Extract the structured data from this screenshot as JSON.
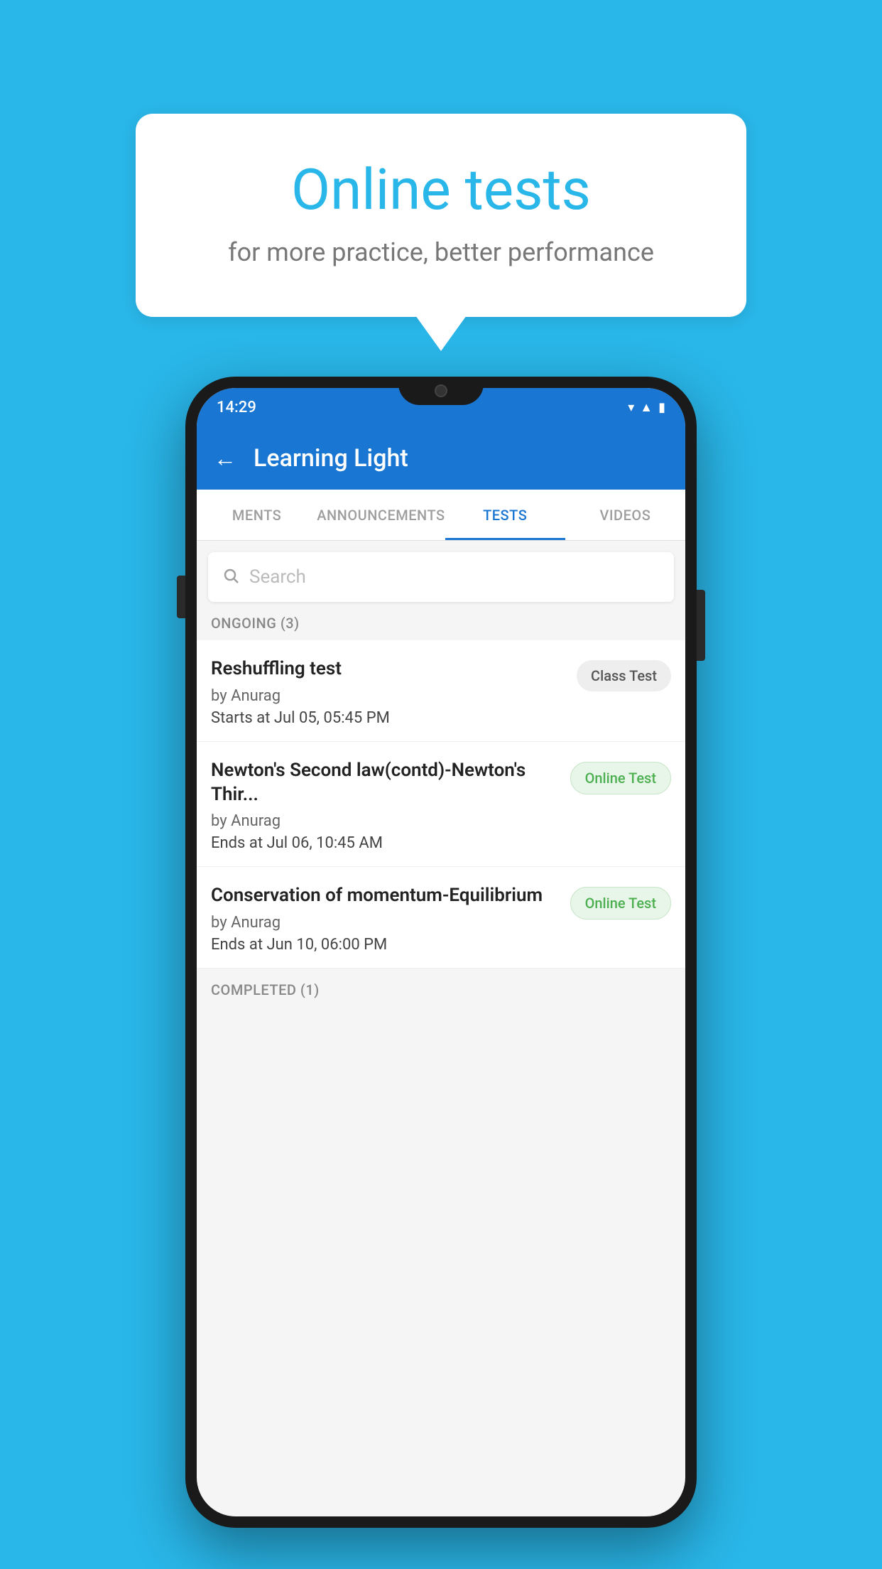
{
  "background": {
    "color": "#29b6e8"
  },
  "speech_bubble": {
    "title": "Online tests",
    "subtitle": "for more practice, better performance"
  },
  "phone": {
    "status_bar": {
      "time": "14:29",
      "icons": [
        "wifi",
        "signal",
        "battery"
      ]
    },
    "app_bar": {
      "title": "Learning Light",
      "back_label": "←"
    },
    "tabs": [
      {
        "label": "MENTS",
        "active": false
      },
      {
        "label": "ANNOUNCEMENTS",
        "active": false
      },
      {
        "label": "TESTS",
        "active": true
      },
      {
        "label": "VIDEOS",
        "active": false
      }
    ],
    "search": {
      "placeholder": "Search"
    },
    "sections": [
      {
        "header": "ONGOING (3)",
        "items": [
          {
            "title": "Reshuffling test",
            "author": "by Anurag",
            "date_label": "Starts at",
            "date_value": "Jul 05, 05:45 PM",
            "badge": "Class Test",
            "badge_type": "class"
          },
          {
            "title": "Newton's Second law(contd)-Newton's Thir...",
            "author": "by Anurag",
            "date_label": "Ends at",
            "date_value": "Jul 06, 10:45 AM",
            "badge": "Online Test",
            "badge_type": "online"
          },
          {
            "title": "Conservation of momentum-Equilibrium",
            "author": "by Anurag",
            "date_label": "Ends at",
            "date_value": "Jun 10, 06:00 PM",
            "badge": "Online Test",
            "badge_type": "online"
          }
        ]
      },
      {
        "header": "COMPLETED (1)",
        "items": []
      }
    ]
  }
}
